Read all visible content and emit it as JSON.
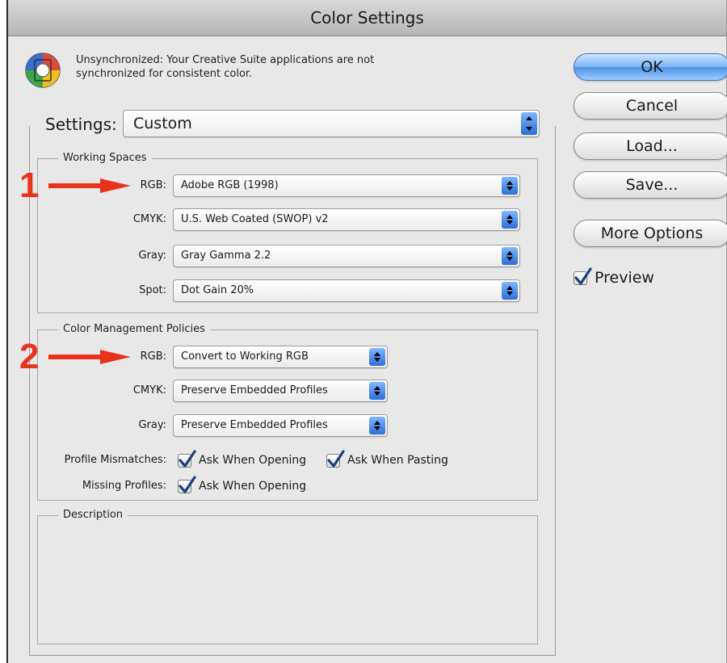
{
  "window": {
    "title": "Color Settings"
  },
  "sync": {
    "icon": "color-wheel-icon",
    "message": "Unsynchronized: Your Creative Suite applications are not synchronized for consistent color."
  },
  "settings": {
    "label": "Settings:",
    "value": "Custom"
  },
  "working_spaces": {
    "title": "Working Spaces",
    "rgb": {
      "label": "RGB:",
      "value": "Adobe RGB (1998)"
    },
    "cmyk": {
      "label": "CMYK:",
      "value": "U.S. Web Coated (SWOP) v2"
    },
    "gray": {
      "label": "Gray:",
      "value": "Gray Gamma 2.2"
    },
    "spot": {
      "label": "Spot:",
      "value": "Dot Gain 20%"
    }
  },
  "policies": {
    "title": "Color Management Policies",
    "rgb": {
      "label": "RGB:",
      "value": "Convert to Working RGB"
    },
    "cmyk": {
      "label": "CMYK:",
      "value": "Preserve Embedded Profiles"
    },
    "gray": {
      "label": "Gray:",
      "value": "Preserve Embedded Profiles"
    },
    "mismatch_label": "Profile Mismatches:",
    "mismatch_open": {
      "label": "Ask When Opening",
      "checked": true
    },
    "mismatch_paste": {
      "label": "Ask When Pasting",
      "checked": true
    },
    "missing_label": "Missing Profiles:",
    "missing_open": {
      "label": "Ask When Opening",
      "checked": true
    }
  },
  "description": {
    "title": "Description",
    "text": ""
  },
  "buttons": {
    "ok": "OK",
    "cancel": "Cancel",
    "load": "Load...",
    "save": "Save...",
    "more": "More Options"
  },
  "preview": {
    "label": "Preview",
    "checked": true
  },
  "annotations": {
    "marker1": "1",
    "marker2": "2",
    "arrow_color": "#e8331a"
  }
}
